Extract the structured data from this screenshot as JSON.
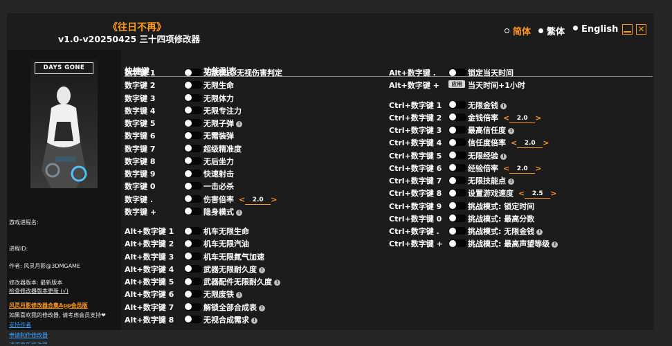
{
  "header": {
    "game_title": "《往日不再》",
    "subtitle": "v1.0-v20250425 三十四项修改器",
    "languages": [
      {
        "label": "简体",
        "active": true
      },
      {
        "label": "繁体",
        "active": false
      },
      {
        "label": "English",
        "active": false
      }
    ]
  },
  "sidebar": {
    "cover_logo": "DAYS GONE",
    "process_name_label": "游戏进程名:",
    "process_id_label": "进程ID:",
    "author": "作者: 风灵月影@3DMGAME",
    "version_label": "修改器版本: 最新版本",
    "check_update": "检查修改器版本更新 (√)",
    "app_promo": "风灵月影修改器合集App会员版",
    "support_prompt": "如果喜欢我的修改器, 请考虑会员支持❤",
    "support_author": "支持作者",
    "request_trainer": "申请制作修改器",
    "more_link": "请求更新修改器"
  },
  "columns": {
    "hotkey": "快捷键",
    "function_list": "功能列表"
  },
  "left_items": [
    {
      "key": "数字键 1",
      "label": "无敌模式/无视伤害判定"
    },
    {
      "key": "数字键 2",
      "label": "无限生命"
    },
    {
      "key": "数字键 3",
      "label": "无限体力"
    },
    {
      "key": "数字键 4",
      "label": "无限专注力"
    },
    {
      "key": "数字键 5",
      "label": "无限子弹",
      "warn": true
    },
    {
      "key": "数字键 6",
      "label": "无需装弹"
    },
    {
      "key": "数字键 7",
      "label": "超级精准度"
    },
    {
      "key": "数字键 8",
      "label": "无后坐力"
    },
    {
      "key": "数字键 9",
      "label": "快速射击"
    },
    {
      "key": "数字键 0",
      "label": "一击必杀"
    },
    {
      "key": "数字键 .",
      "label": "伤害倍率",
      "value": "2.0"
    },
    {
      "key": "数字键 +",
      "label": "隐身模式",
      "warn": true
    },
    {
      "key": "Alt+数字键 1",
      "label": "机车无限生命"
    },
    {
      "key": "Alt+数字键 2",
      "label": "机车无限汽油"
    },
    {
      "key": "Alt+数字键 3",
      "label": "机车无限氮气加速"
    },
    {
      "key": "Alt+数字键 4",
      "label": "武器无限耐久度",
      "warn": true
    },
    {
      "key": "Alt+数字键 5",
      "label": "武器配件无限耐久度",
      "warn": true
    },
    {
      "key": "Alt+数字键 6",
      "label": "无限废铁",
      "warn": true
    },
    {
      "key": "Alt+数字键 7",
      "label": "解锁全部合成表",
      "warn": true
    },
    {
      "key": "Alt+数字键 8",
      "label": "无视合成需求",
      "warn": true
    }
  ],
  "right_items": [
    {
      "key": "Alt+数字键 .",
      "label": "锁定当天时间"
    },
    {
      "key": "Alt+数字键 +",
      "label": "当天时间+1小时",
      "button": "应用"
    },
    {
      "key": "Ctrl+数字键 1",
      "label": "无限金钱",
      "warn": true
    },
    {
      "key": "Ctrl+数字键 2",
      "label": "金钱倍率",
      "value": "2.0"
    },
    {
      "key": "Ctrl+数字键 3",
      "label": "最高信任度",
      "warn": true
    },
    {
      "key": "Ctrl+数字键 4",
      "label": "信任度倍率",
      "value": "2.0"
    },
    {
      "key": "Ctrl+数字键 5",
      "label": "无限经验",
      "warn": true
    },
    {
      "key": "Ctrl+数字键 6",
      "label": "经验倍率",
      "value": "2.0"
    },
    {
      "key": "Ctrl+数字键 7",
      "label": "无限技能点",
      "warn": true
    },
    {
      "key": "Ctrl+数字键 8",
      "label": "设置游戏速度",
      "value": "2.5"
    },
    {
      "key": "Ctrl+数字键 9",
      "label": "挑战模式: 锁定时间"
    },
    {
      "key": "Ctrl+数字键 0",
      "label": "挑战模式: 最高分数"
    },
    {
      "key": "Ctrl+数字键 .",
      "label": "挑战模式: 无限金钱",
      "warn": true
    },
    {
      "key": "Ctrl+数字键 +",
      "label": "挑战模式: 最高声望等级",
      "warn": true
    }
  ],
  "colors": {
    "accent": "#ff9a1f",
    "link": "#39a0ff"
  }
}
